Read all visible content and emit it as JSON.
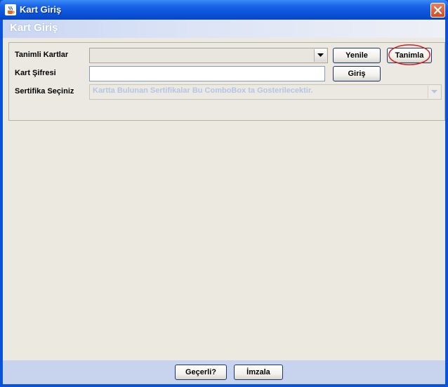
{
  "window": {
    "title": "Kart Giriş",
    "title_icon": "java-cup-icon",
    "close_icon": "close-icon"
  },
  "header": {
    "title": "Kart Giriş"
  },
  "form": {
    "tanimli_kartlar_label": "Tanimli Kartlar",
    "tanimli_kartlar_value": "",
    "kart_sifresi_label": "Kart Şifresi",
    "kart_sifresi_value": "",
    "sertifika_label": "Sertifika Seçiniz",
    "sertifika_value": "Kartta Bulunan Sertifikalar Bu ComboBox ta Gosterilecektir."
  },
  "buttons": {
    "yenile": "Yenile",
    "tanimla": "Tanimla",
    "giris": "Giriş",
    "gecerli": "Geçerli?",
    "imzala": "İmzala"
  },
  "colors": {
    "titlebar": "#0a52d8",
    "panel_bg": "#eceae0",
    "disabled_text": "#b4c6e6",
    "highlight_ring": "#d42020"
  }
}
